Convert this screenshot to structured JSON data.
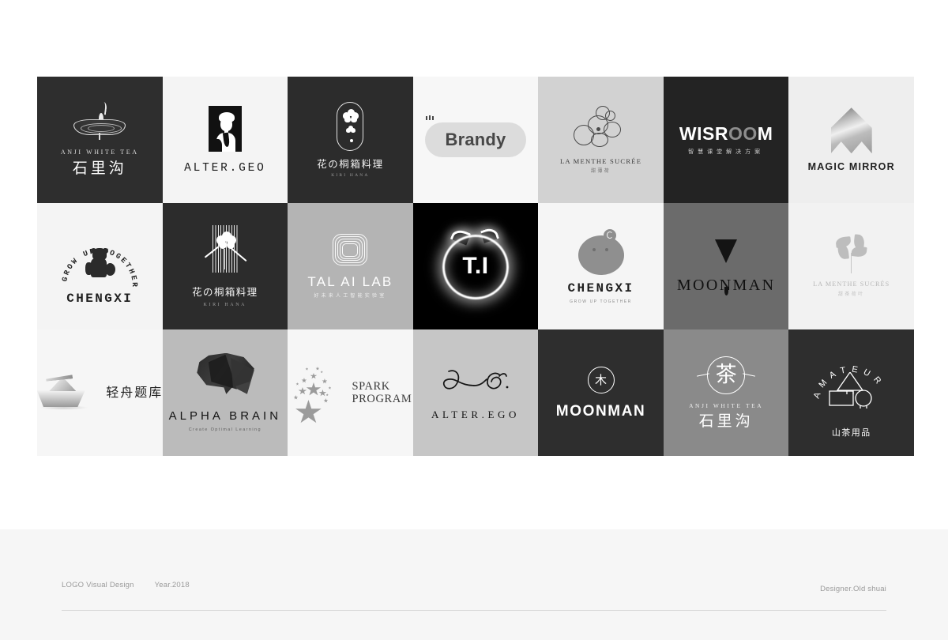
{
  "page": {
    "background": "#ffffff",
    "footer_band_color": "#f6f6f6"
  },
  "footer": {
    "project_label": "LOGO Visual Design",
    "year_label": "Year.2018",
    "designer_label": "Designer.Old shuai"
  },
  "grid": {
    "columns": 7,
    "rows": 3,
    "cells": [
      {
        "id": "anji-white-tea-dark",
        "name": "Anji White Tea",
        "background": "#2e2e2e",
        "wordmark": "ANJI WHITE TEA",
        "registered": "®",
        "chinese": "石里沟",
        "mark": "tea-bowl-icon"
      },
      {
        "id": "alter-geo",
        "name": "Alter.Geo",
        "background": "#f4f4f4",
        "wordmark": "ALTER.GEO",
        "mark": "portrait-frame-icon"
      },
      {
        "id": "hana-kiri-dark",
        "name": "Hana Kiri Restaurant",
        "background": "#2c2c2c",
        "chinese": "花の桐箱料理",
        "subtitle": "KIRI HANA",
        "mark": "blossom-capsule-icon"
      },
      {
        "id": "brandy",
        "name": "Brandy",
        "background": "#f7f7f7",
        "wordmark": "Brandy",
        "pill_color": "#dcdcdc",
        "mark": "crown-robot-icon"
      },
      {
        "id": "la-menthe-sucree-rabbit",
        "name": "La Menthe Sucrée",
        "background": "#d2d2d2",
        "wordmark": "LA MENTHE SUCRÉE",
        "chinese": "甜薄荷",
        "mark": "line-rabbit-icon"
      },
      {
        "id": "wisroom",
        "name": "Wisroom",
        "background": "#232323",
        "wordmark_part1": "WISR",
        "wordmark_part2": "OO",
        "wordmark_part3": "M",
        "chinese": "智慧课堂解决方案",
        "accent_gray": "#8e8e8e"
      },
      {
        "id": "magic-mirror",
        "name": "Magic Mirror",
        "background": "#eeeeee",
        "wordmark": "MAGIC MIRROR",
        "mark": "gradient-crown-icon"
      },
      {
        "id": "chengxi-badge",
        "name": "Chengxi",
        "background": "#f4f4f4",
        "wordmark": "CHENGXI",
        "arc_text": "GROW UP TOGETHER",
        "mark": "bear-badge-icon"
      },
      {
        "id": "kiri-hana-bars",
        "name": "Kiri Hana",
        "background": "#2c2c2c",
        "chinese": "花の桐箱料理",
        "subtitle": "KIRI HANA",
        "mark": "flower-bars-icon"
      },
      {
        "id": "tal-ai-lab",
        "name": "TAL AI Lab",
        "background": "#b4b4b4",
        "wordmark": "TAL AI LAB",
        "chinese": "好未来人工智能实验室",
        "mark": "nested-triangle-icon"
      },
      {
        "id": "t-i-glow",
        "name": "T.I",
        "background": "#000000",
        "wordmark": "T.I",
        "mark": "glowing-cat-ring-icon"
      },
      {
        "id": "chengxi-solid",
        "name": "Chengxi",
        "background": "#f5f5f5",
        "wordmark": "CHENGXI",
        "subtitle": "GROW UP TOGETHER",
        "mark": "bear-circle-icon"
      },
      {
        "id": "moonman-triangle",
        "name": "Moonman",
        "background": "#6b6b6b",
        "wordmark": "MOONMAN",
        "mark": "inverted-triangle-icon"
      },
      {
        "id": "la-menthe-sucree-leaf",
        "name": "La Menthe Sucrée",
        "background": "#f2f2f2",
        "wordmark": "LA MENTHE SUCRÉS",
        "chinese": "甜茶荷叶",
        "mark": "mint-leaf-icon"
      },
      {
        "id": "qingzhou-tiku",
        "name": "Qingzhou Tiku",
        "background": "#f6f6f6",
        "chinese": "轻舟题库",
        "mark": "paper-boat-icon"
      },
      {
        "id": "alpha-brain",
        "name": "Alpha Brain",
        "background": "#bbbbbb",
        "wordmark": "ALPHA BRAIN",
        "subtitle": "Create Optimal Learning",
        "mark": "polygon-brain-icon"
      },
      {
        "id": "spark-program",
        "name": "Spark Program",
        "background": "#f6f6f6",
        "wordmark_line1": "SPARK",
        "wordmark_line2": "PROGRAM",
        "mark": "star-burst-icon"
      },
      {
        "id": "alter-ego",
        "name": "Alter.Ego",
        "background": "#c6c6c6",
        "script": "A E",
        "wordmark": "ALTER.EGO",
        "mark": "script-monogram-icon"
      },
      {
        "id": "moonman-badge",
        "name": "Moonman",
        "background": "#2e2e2e",
        "wordmark": "MOONMAN",
        "glyph": "木",
        "mark": "circle-badge-icon"
      },
      {
        "id": "anji-white-tea-gray",
        "name": "Anji White Tea",
        "background": "#8a8a8a",
        "wordmark": "ANJI WHITE TEA",
        "chinese": "石里沟",
        "glyph": "茶",
        "mark": "tea-circle-icon"
      },
      {
        "id": "amateur",
        "name": "Amateur",
        "background": "#2e2e2e",
        "arc_text": "AMATEUR",
        "chinese": "山茶用品",
        "mark": "geometric-shapes-icon"
      }
    ]
  }
}
